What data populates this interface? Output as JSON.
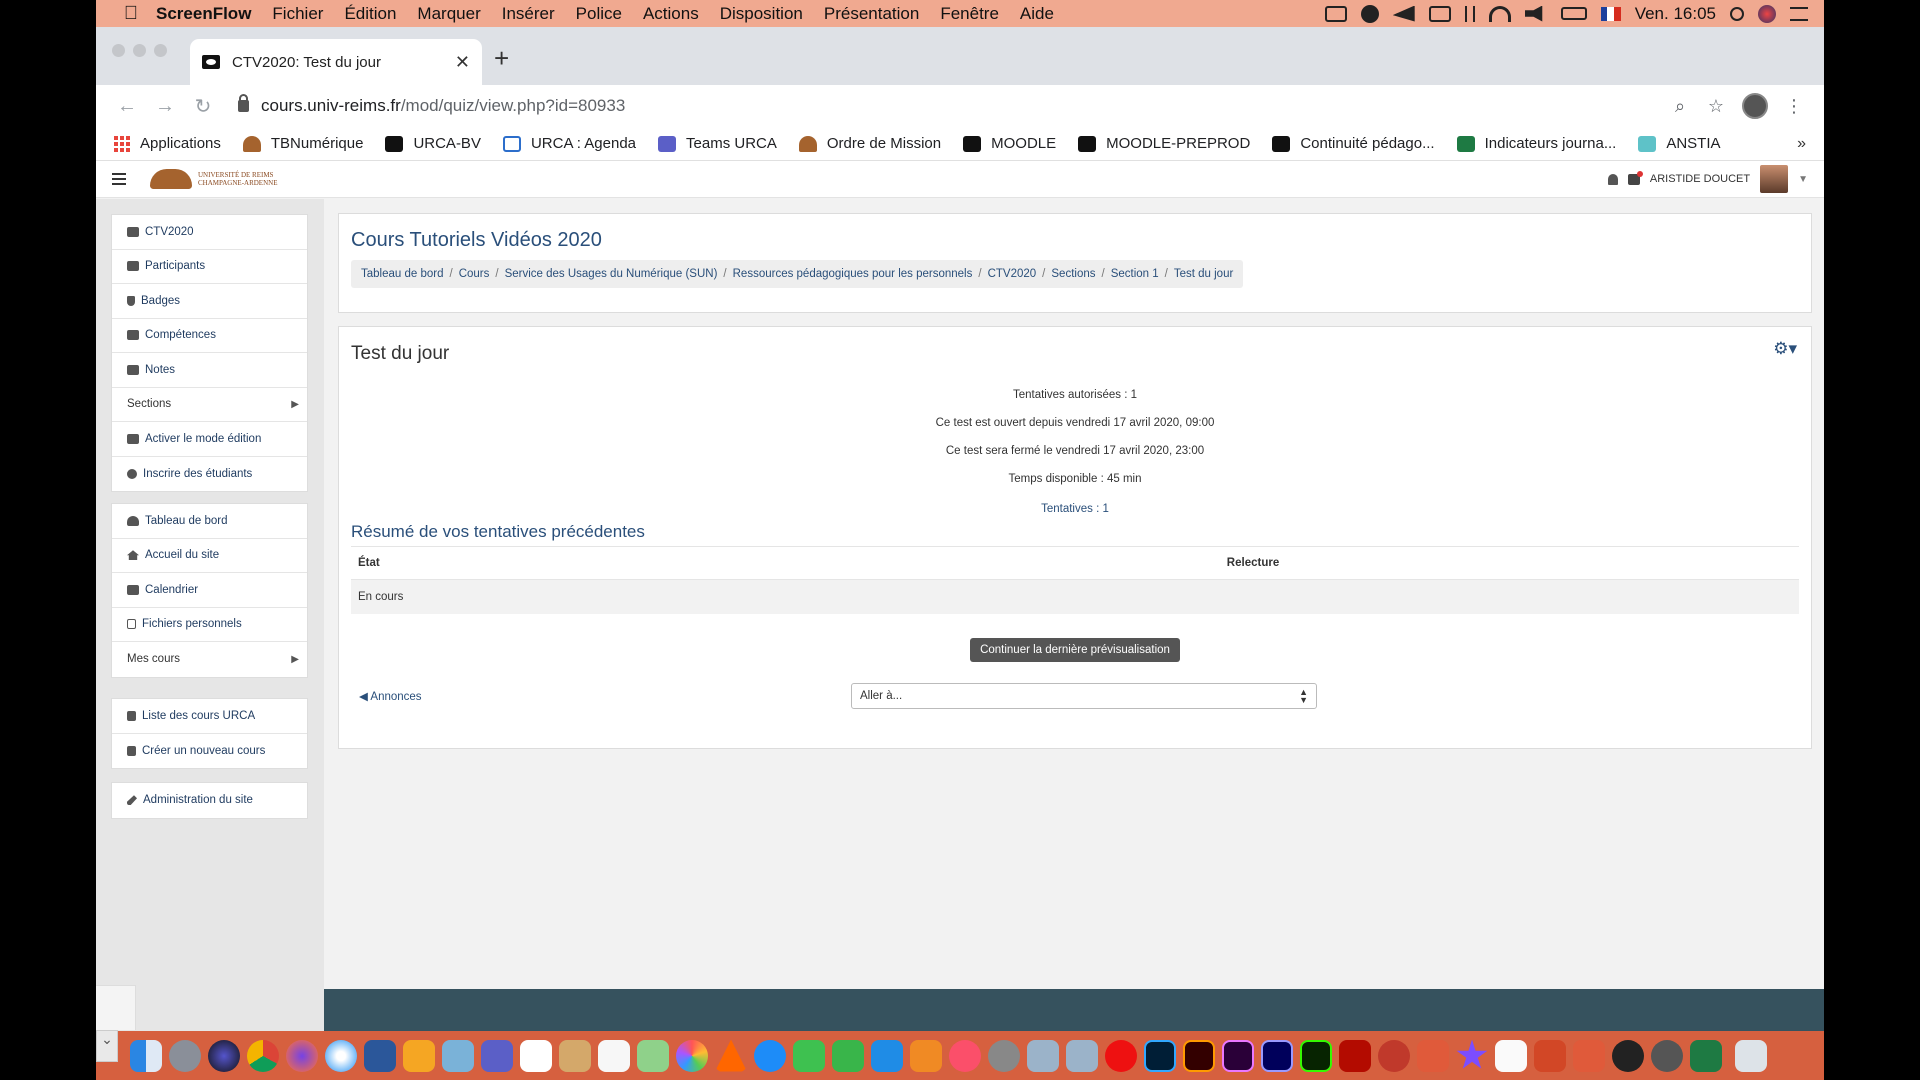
{
  "menubar": {
    "app": "ScreenFlow",
    "items": [
      "Fichier",
      "Édition",
      "Marquer",
      "Insérer",
      "Police",
      "Actions",
      "Disposition",
      "Présentation",
      "Fenêtre",
      "Aide"
    ],
    "clock": "Ven. 16:05"
  },
  "browser": {
    "tab_title": "CTV2020: Test du jour",
    "url_host": "cours.univ-reims.fr",
    "url_path": "/mod/quiz/view.php?id=80933",
    "bookmarks": [
      "Applications",
      "TBNumérique",
      "URCA-BV",
      "URCA : Agenda",
      "Teams URCA",
      "Ordre de Mission",
      "MOODLE",
      "MOODLE-PREPROD",
      "Continuité pédago...",
      "Indicateurs journa...",
      "ANSTIA"
    ],
    "more": "»"
  },
  "moodle": {
    "logo_text": "UNIVERSITÉ DE REIMS CHAMPAGNE-ARDENNE",
    "user_name": "ARISTIDE DOUCET",
    "nav_block1": [
      "CTV2020",
      "Participants",
      "Badges",
      "Compétences",
      "Notes",
      "Sections",
      "Activer le mode édition",
      "Inscrire des étudiants"
    ],
    "nav_block2": [
      "Tableau de bord",
      "Accueil du site",
      "Calendrier",
      "Fichiers personnels",
      "Mes cours"
    ],
    "nav_block3": [
      "Liste des cours URCA",
      "Créer un nouveau cours"
    ],
    "nav_block4": [
      "Administration du site"
    ],
    "course_title": "Cours Tutoriels Vidéos 2020",
    "breadcrumb": [
      "Tableau de bord",
      "Cours",
      "Service des Usages du Numérique (SUN)",
      "Ressources pédagogiques pour les personnels",
      "CTV2020",
      "Sections",
      "Section 1",
      "Test du jour"
    ],
    "quiz_title": "Test du jour",
    "info": [
      "Tentatives autorisées : 1",
      "Ce test est ouvert depuis vendredi 17 avril 2020, 09:00",
      "Ce test sera fermé le vendredi 17 avril 2020, 23:00",
      "Temps disponible : 45 min"
    ],
    "attempts_link": "Tentatives : 1",
    "summary_title": "Résumé de vos tentatives précédentes",
    "table_headers": [
      "État",
      "Relecture"
    ],
    "table_rows": [
      [
        "En cours",
        ""
      ]
    ],
    "continue_button": "Continuer la dernière prévisualisation",
    "prev_link": "Annonces",
    "jump_placeholder": "Aller à..."
  },
  "colors": {
    "menubar": "#f0a990",
    "dock": "#d6603f",
    "link": "#2a4f7a",
    "footer": "#36525e"
  }
}
